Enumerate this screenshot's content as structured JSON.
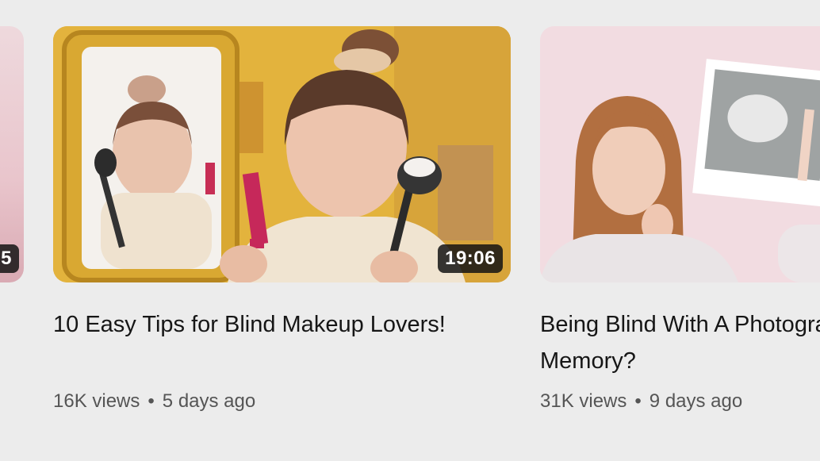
{
  "videos": [
    {
      "duration": "5"
    },
    {
      "title": "10 Easy Tips for Blind Makeup Lovers!",
      "views": "16K views",
      "age": "5 days ago",
      "duration": "19:06"
    },
    {
      "title": "Being Blind With A Photographic Memory?",
      "views": "31K views",
      "age": "9 days ago"
    }
  ],
  "separator": "•",
  "colors": {
    "background": "#ececec",
    "title": "#161616",
    "meta": "#555555",
    "duration_badge": "#141414"
  }
}
